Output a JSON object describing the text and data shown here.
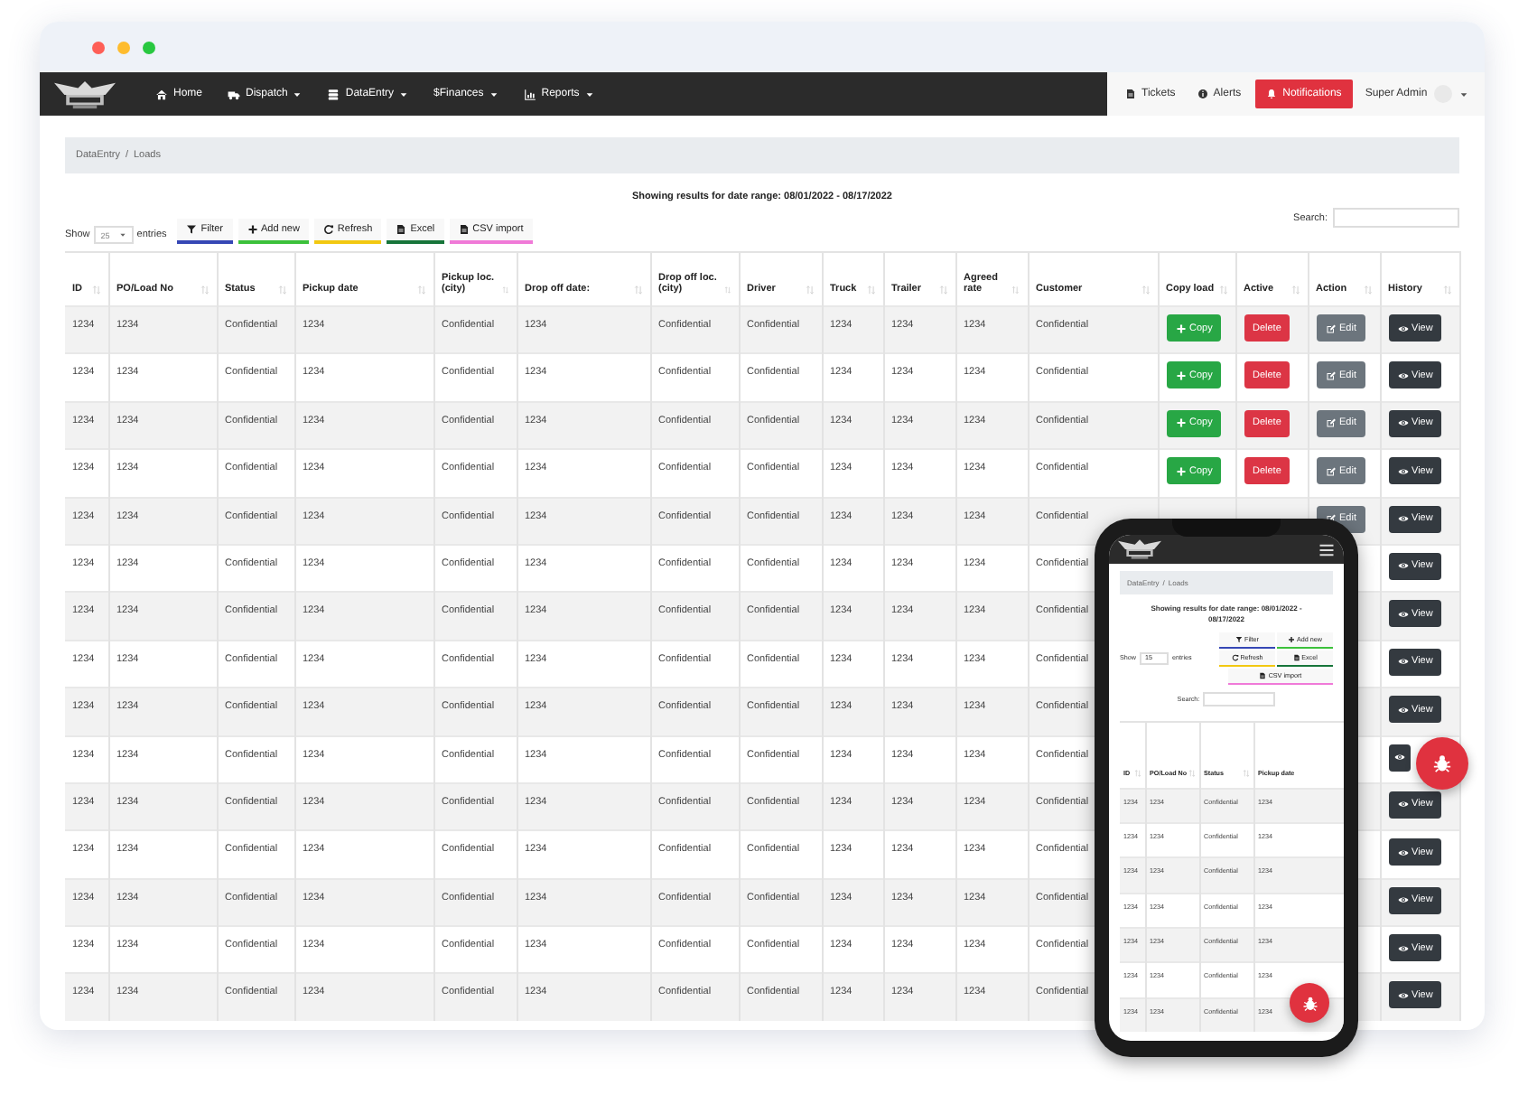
{
  "navbar": {
    "menu": [
      {
        "label": "Home",
        "dropdown": false
      },
      {
        "label": "Dispatch",
        "dropdown": true
      },
      {
        "label": "DataEntry",
        "dropdown": true
      },
      {
        "label": "Finances",
        "glyph": "$",
        "dropdown": true
      },
      {
        "label": "Reports",
        "dropdown": true
      }
    ],
    "right": [
      {
        "label": "Tickets",
        "kind": "link"
      },
      {
        "label": "Alerts",
        "kind": "link"
      },
      {
        "label": "Notifications",
        "kind": "alert"
      }
    ],
    "user": "Super Admin"
  },
  "breadcrumb": {
    "items": [
      "DataEntry",
      "Loads"
    ],
    "separator": "/"
  },
  "summary": "Showing results for date range: 08/01/2022 - 08/17/2022",
  "length": {
    "before": "Show",
    "value": "25",
    "after": "entries"
  },
  "toolbar": [
    {
      "label": "Filter",
      "color": "#3647b5"
    },
    {
      "label": "Add new",
      "color": "#3cc13b"
    },
    {
      "label": "Refresh",
      "color": "#f2c811"
    },
    {
      "label": "Excel",
      "color": "#17753a"
    },
    {
      "label": "CSV import",
      "color": "#f07ad8"
    }
  ],
  "search_label": "Search:",
  "table": {
    "columns": [
      "ID",
      "PO/Load No",
      "Status",
      "Pickup date",
      "Pickup loc. (city)",
      "Drop off date:",
      "Drop off loc. (city)",
      "Driver",
      "Truck",
      "Trailer",
      "Agreed rate",
      "Customer",
      "Copy load",
      "Active",
      "Action",
      "History"
    ],
    "rows": [
      {
        "cells": [
          "1234",
          "1234",
          "Confidential",
          "1234",
          "Confidential",
          "1234",
          "Confidential",
          "Confidential",
          "1234",
          "1234",
          "1234",
          "Confidential"
        ],
        "actions": [
          {
            "kind": "copy",
            "label": "Copy"
          },
          {
            "kind": "delete",
            "label": "Delete"
          },
          {
            "kind": "edit",
            "label": "Edit"
          },
          {
            "kind": "view",
            "label": "View"
          }
        ]
      },
      {
        "cells": [
          "1234",
          "1234",
          "Confidential",
          "1234",
          "Confidential",
          "1234",
          "Confidential",
          "Confidential",
          "1234",
          "1234",
          "1234",
          "Confidential"
        ],
        "actions": [
          {
            "kind": "copy",
            "label": "Copy"
          },
          {
            "kind": "delete",
            "label": "Delete"
          },
          {
            "kind": "edit",
            "label": "Edit"
          },
          {
            "kind": "view",
            "label": "View"
          }
        ]
      },
      {
        "cells": [
          "1234",
          "1234",
          "Confidential",
          "1234",
          "Confidential",
          "1234",
          "Confidential",
          "Confidential",
          "1234",
          "1234",
          "1234",
          "Confidential"
        ],
        "actions": [
          {
            "kind": "copy",
            "label": "Copy"
          },
          {
            "kind": "delete",
            "label": "Delete"
          },
          {
            "kind": "edit",
            "label": "Edit"
          },
          {
            "kind": "view",
            "label": "View"
          }
        ]
      },
      {
        "cells": [
          "1234",
          "1234",
          "Confidential",
          "1234",
          "Confidential",
          "1234",
          "Confidential",
          "Confidential",
          "1234",
          "1234",
          "1234",
          "Confidential"
        ],
        "actions": [
          {
            "kind": "copy",
            "label": "Copy"
          },
          {
            "kind": "delete",
            "label": "Delete"
          },
          {
            "kind": "edit",
            "label": "Edit"
          },
          {
            "kind": "view",
            "label": "View"
          }
        ]
      },
      {
        "cells": [
          "1234",
          "1234",
          "Confidential",
          "1234",
          "Confidential",
          "1234",
          "Confidential",
          "Confidential",
          "1234",
          "1234",
          "1234",
          "Confidential"
        ],
        "actions": [
          {
            "kind": "edit",
            "label": "Edit"
          },
          {
            "kind": "view",
            "label": "View"
          }
        ]
      },
      {
        "cells": [
          "1234",
          "1234",
          "Confidential",
          "1234",
          "Confidential",
          "1234",
          "Confidential",
          "Confidential",
          "1234",
          "1234",
          "1234",
          "Confidential"
        ],
        "actions": [
          {
            "kind": "view",
            "label": "View"
          }
        ]
      },
      {
        "cells": [
          "1234",
          "1234",
          "Confidential",
          "1234",
          "Confidential",
          "1234",
          "Confidential",
          "Confidential",
          "1234",
          "1234",
          "1234",
          "Confidential"
        ],
        "actions": [
          {
            "kind": "view",
            "label": "View"
          }
        ]
      },
      {
        "cells": [
          "1234",
          "1234",
          "Confidential",
          "1234",
          "Confidential",
          "1234",
          "Confidential",
          "Confidential",
          "1234",
          "1234",
          "1234",
          "Confidential"
        ],
        "actions": [
          {
            "kind": "view",
            "label": "View"
          }
        ]
      },
      {
        "cells": [
          "1234",
          "1234",
          "Confidential",
          "1234",
          "Confidential",
          "1234",
          "Confidential",
          "Confidential",
          "1234",
          "1234",
          "1234",
          "Confidential"
        ],
        "actions": [
          {
            "kind": "view",
            "label": "View"
          }
        ]
      },
      {
        "cells": [
          "1234",
          "1234",
          "Confidential",
          "1234",
          "Confidential",
          "1234",
          "Confidential",
          "Confidential",
          "1234",
          "1234",
          "1234",
          "Confidential"
        ],
        "actions": [
          {
            "kind": "view"
          }
        ]
      },
      {
        "cells": [
          "1234",
          "1234",
          "Confidential",
          "1234",
          "Confidential",
          "1234",
          "Confidential",
          "Confidential",
          "1234",
          "1234",
          "1234",
          "Confidential"
        ],
        "actions": [
          {
            "kind": "view",
            "label": "View"
          }
        ]
      },
      {
        "cells": [
          "1234",
          "1234",
          "Confidential",
          "1234",
          "Confidential",
          "1234",
          "Confidential",
          "Confidential",
          "1234",
          "1234",
          "1234",
          "Confidential"
        ],
        "actions": [
          {
            "kind": "view",
            "label": "View"
          }
        ]
      },
      {
        "cells": [
          "1234",
          "1234",
          "Confidential",
          "1234",
          "Confidential",
          "1234",
          "Confidential",
          "Confidential",
          "1234",
          "1234",
          "1234",
          "Confidential"
        ],
        "actions": [
          {
            "kind": "view",
            "label": "View"
          }
        ]
      },
      {
        "cells": [
          "1234",
          "1234",
          "Confidential",
          "1234",
          "Confidential",
          "1234",
          "Confidential",
          "Confidential",
          "1234",
          "1234",
          "1234",
          "Confidential"
        ],
        "actions": [
          {
            "kind": "view",
            "label": "View"
          }
        ]
      },
      {
        "cells": [
          "1234",
          "1234",
          "Confidential",
          "1234",
          "Confidential",
          "1234",
          "Confidential",
          "Confidential",
          "1234",
          "1234",
          "1234",
          "Confidential"
        ],
        "actions": [
          {
            "kind": "view",
            "label": "View"
          }
        ]
      }
    ]
  },
  "phone": {
    "breadcrumb": {
      "items": [
        "DataEntry",
        "Loads"
      ],
      "separator": "/"
    },
    "summary": "Showing results for date range: 08/01/2022 - 08/17/2022",
    "length": {
      "before": "Show",
      "value": "15",
      "after": "entries"
    },
    "toolbar": [
      {
        "label": "Filter",
        "color": "#3647b5"
      },
      {
        "label": "Add new",
        "color": "#3cc13b"
      },
      {
        "label": "Refresh",
        "color": "#f2c811"
      },
      {
        "label": "Excel",
        "color": "#17753a"
      },
      {
        "label": "CSV import",
        "color": "#f07ad8"
      }
    ],
    "search_label": "Search:",
    "columns": [
      "ID",
      "PO/Load No",
      "Status",
      "Pickup date"
    ],
    "rows": [
      [
        "1234",
        "1234",
        "Confidential",
        "1234"
      ],
      [
        "1234",
        "1234",
        "Confidential",
        "1234"
      ],
      [
        "1234",
        "1234",
        "Confidential",
        "1234"
      ],
      [
        "1234",
        "1234",
        "Confidential",
        "1234"
      ],
      [
        "1234",
        "1234",
        "Confidential",
        "1234"
      ],
      [
        "1234",
        "1234",
        "Confidential",
        "1234"
      ],
      [
        "1234",
        "1234",
        "Confidential",
        "1234"
      ]
    ]
  }
}
